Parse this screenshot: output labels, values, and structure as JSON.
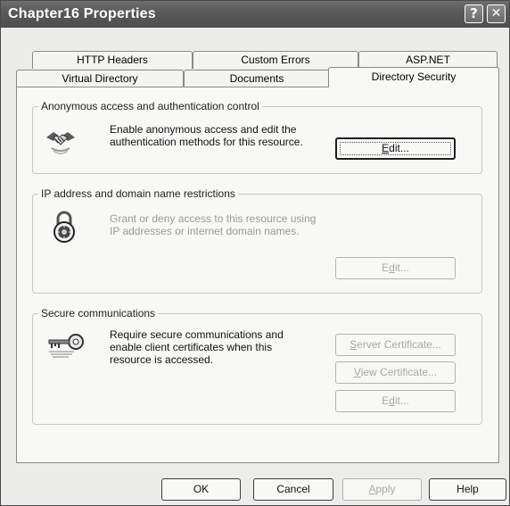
{
  "window": {
    "title": "Chapter16 Properties",
    "help_glyph": "?",
    "close_glyph": "✕"
  },
  "tabs": {
    "row1": [
      {
        "label": "HTTP Headers"
      },
      {
        "label": "Custom Errors"
      },
      {
        "label": "ASP.NET"
      }
    ],
    "row2": [
      {
        "label": "Virtual Directory"
      },
      {
        "label": "Documents"
      },
      {
        "label": "Directory Security",
        "active": true
      }
    ]
  },
  "sections": {
    "anonymous": {
      "legend": "Anonymous access and authentication control",
      "line1": "Enable anonymous access and edit the",
      "line2": "authentication methods for this resource.",
      "icon": "handshake-icon",
      "edit": {
        "pre": "",
        "ul": "E",
        "post": "dit..."
      }
    },
    "ip": {
      "legend": "IP address and domain name restrictions",
      "line1": "Grant or deny access to this resource using",
      "line2": "IP addresses or internet domain names.",
      "icon": "padlock-icon",
      "edit": {
        "pre": "E",
        "ul": "d",
        "post": "it..."
      }
    },
    "secure": {
      "legend": "Secure communications",
      "line1": "Require secure communications and",
      "line2": "enable client certificates when this",
      "line3": "resource is accessed.",
      "icon": "key-icon",
      "server_cert": {
        "pre": "",
        "ul": "S",
        "post": "erver Certificate..."
      },
      "view_cert": {
        "pre": "",
        "ul": "V",
        "post": "iew Certificate..."
      },
      "edit": {
        "pre": "E",
        "ul": "d",
        "post": "it..."
      }
    }
  },
  "footer": {
    "ok": "OK",
    "cancel": "Cancel",
    "apply": {
      "ul": "A",
      "post": "pply"
    },
    "help": "Help"
  }
}
